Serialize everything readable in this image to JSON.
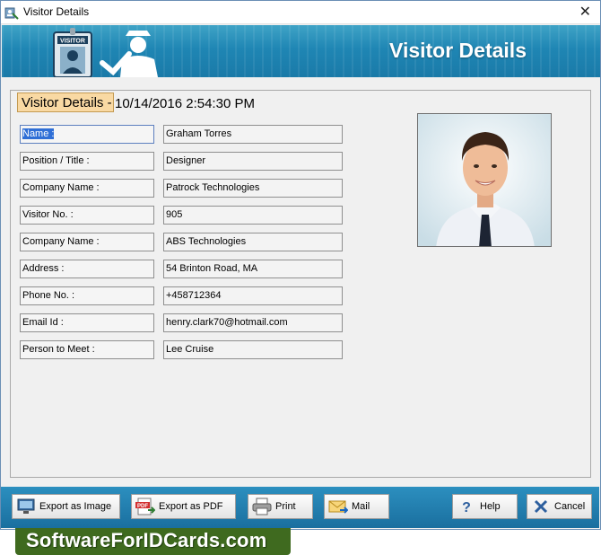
{
  "window": {
    "title": "Visitor Details"
  },
  "banner": {
    "title": "Visitor Details",
    "badge_text": "VISITOR"
  },
  "group": {
    "label": "Visitor Details -",
    "datetime": "10/14/2016 2:54:30 PM"
  },
  "fields": [
    {
      "label": "Name :",
      "value": "Graham Torres"
    },
    {
      "label": "Position / Title :",
      "value": "Designer"
    },
    {
      "label": "Company Name :",
      "value": "Patrock Technologies"
    },
    {
      "label": "Visitor No. :",
      "value": "905"
    },
    {
      "label": "Company Name :",
      "value": "ABS Technologies"
    },
    {
      "label": "Address :",
      "value": "54 Brinton Road, MA"
    },
    {
      "label": "Phone No. :",
      "value": "+458712364"
    },
    {
      "label": "Email Id :",
      "value": "henry.clark70@hotmail.com"
    },
    {
      "label": "Person to Meet :",
      "value": "Lee Cruise"
    }
  ],
  "buttons": {
    "export_image": "Export as Image",
    "export_pdf": "Export as PDF",
    "print": "Print",
    "mail": "Mail",
    "help": "Help",
    "cancel": "Cancel"
  },
  "watermark": "SoftwareForIDCards.com",
  "colors": {
    "banner": "#1f86b4",
    "label_highlight": "#f9d9a3",
    "watermark_bg": "#3f6a1f",
    "selection": "#2f6fd6"
  }
}
